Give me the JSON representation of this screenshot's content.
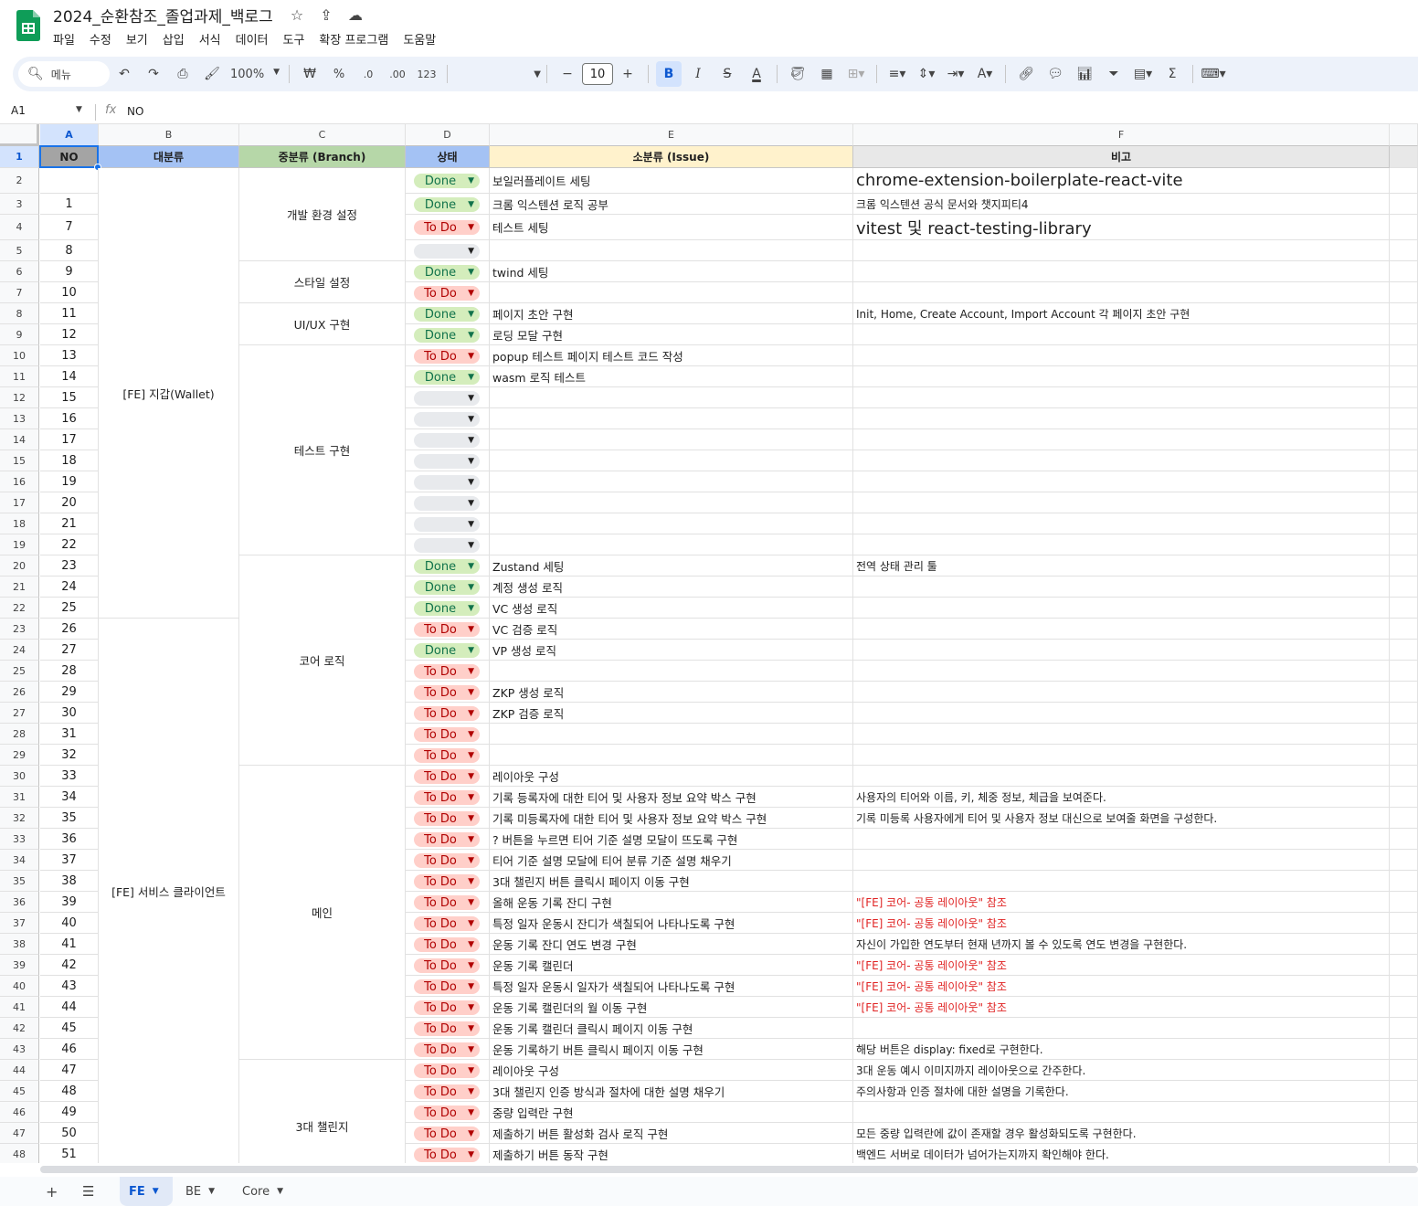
{
  "title_bar": {
    "doc_title": "2024_순환참조_졸업과제_백로그",
    "menu": [
      "파일",
      "수정",
      "보기",
      "삽입",
      "서식",
      "데이터",
      "도구",
      "확장 프로그램",
      "도움말"
    ]
  },
  "toolbar": {
    "search_placeholder": "메뉴",
    "zoom": "100%",
    "currency": "₩",
    "percent": "%",
    "dec_decrease": ".0",
    "dec_increase": ".00",
    "number_format": "123",
    "font_size": "10",
    "bold": "B",
    "italic": "I",
    "strike": "S",
    "text_color": "A"
  },
  "formula_bar": {
    "name_box": "A1",
    "value": "NO"
  },
  "columns": [
    "A",
    "B",
    "C",
    "D",
    "E",
    "F"
  ],
  "header_row": {
    "no": "NO",
    "category": "대분류",
    "branch": "중분류 (Branch)",
    "status": "상태",
    "issue": "소분류 (Issue)",
    "note": "비고"
  },
  "groups": {
    "category": [
      "[FE] 지갑(Wallet)",
      "[FE] 서비스 클라이언트"
    ],
    "branch": [
      "개발 환경 설정",
      "스타일 설정",
      "UI/UX 구현",
      "테스트 구현",
      "코어 로직",
      "메인",
      "3대 챌린지"
    ]
  },
  "rows": [
    {
      "r": "2",
      "no": "",
      "status": "Done",
      "issue": "보일러플레이트 세팅",
      "note": "chrome-extension-boilerplate-react-vite",
      "note_style": "large"
    },
    {
      "r": "3",
      "no": "1",
      "status": "Done",
      "issue": "크롬 익스텐션 로직 공부",
      "note": "크롬 익스텐션 공식 문서와 챗지피티4",
      "note_style": ""
    },
    {
      "r": "4",
      "no": "7",
      "status": "To Do",
      "issue": "테스트 세팅",
      "note": "vitest 및 react-testing-library",
      "note_style": "large"
    },
    {
      "r": "5",
      "no": "8",
      "status": "",
      "issue": "",
      "note": "",
      "note_style": ""
    },
    {
      "r": "6",
      "no": "9",
      "status": "Done",
      "issue": "twind 세팅",
      "note": "",
      "note_style": ""
    },
    {
      "r": "7",
      "no": "10",
      "status": "To Do",
      "issue": "",
      "note": "",
      "note_style": ""
    },
    {
      "r": "8",
      "no": "11",
      "status": "Done",
      "issue": "페이지 초안 구현",
      "note": "Init, Home, Create Account, Import Account 각 페이지 초안 구현",
      "note_style": ""
    },
    {
      "r": "9",
      "no": "12",
      "status": "Done",
      "issue": "로딩 모달 구현",
      "note": "",
      "note_style": ""
    },
    {
      "r": "10",
      "no": "13",
      "status": "To Do",
      "issue": "popup 테스트 페이지 테스트 코드 작성",
      "note": "",
      "note_style": ""
    },
    {
      "r": "11",
      "no": "14",
      "status": "Done",
      "issue": "wasm 로직 테스트",
      "note": "",
      "note_style": ""
    },
    {
      "r": "12",
      "no": "15",
      "status": "",
      "issue": "",
      "note": "",
      "note_style": ""
    },
    {
      "r": "13",
      "no": "16",
      "status": "",
      "issue": "",
      "note": "",
      "note_style": ""
    },
    {
      "r": "14",
      "no": "17",
      "status": "",
      "issue": "",
      "note": "",
      "note_style": ""
    },
    {
      "r": "15",
      "no": "18",
      "status": "",
      "issue": "",
      "note": "",
      "note_style": ""
    },
    {
      "r": "16",
      "no": "19",
      "status": "",
      "issue": "",
      "note": "",
      "note_style": ""
    },
    {
      "r": "17",
      "no": "20",
      "status": "",
      "issue": "",
      "note": "",
      "note_style": ""
    },
    {
      "r": "18",
      "no": "21",
      "status": "",
      "issue": "",
      "note": "",
      "note_style": ""
    },
    {
      "r": "19",
      "no": "22",
      "status": "",
      "issue": "",
      "note": "",
      "note_style": ""
    },
    {
      "r": "20",
      "no": "23",
      "status": "Done",
      "issue": "Zustand 세팅",
      "note": "전역 상태 관리 툴",
      "note_style": ""
    },
    {
      "r": "21",
      "no": "24",
      "status": "Done",
      "issue": "계정 생성 로직",
      "note": "",
      "note_style": ""
    },
    {
      "r": "22",
      "no": "25",
      "status": "Done",
      "issue": "VC 생성 로직",
      "note": "",
      "note_style": ""
    },
    {
      "r": "23",
      "no": "26",
      "status": "To Do",
      "issue": "VC 검증 로직",
      "note": "",
      "note_style": ""
    },
    {
      "r": "24",
      "no": "27",
      "status": "Done",
      "issue": "VP 생성 로직",
      "note": "",
      "note_style": ""
    },
    {
      "r": "25",
      "no": "28",
      "status": "To Do",
      "issue": "",
      "note": "",
      "note_style": ""
    },
    {
      "r": "26",
      "no": "29",
      "status": "To Do",
      "issue": "ZKP 생성 로직",
      "note": "",
      "note_style": ""
    },
    {
      "r": "27",
      "no": "30",
      "status": "To Do",
      "issue": "ZKP 검증 로직",
      "note": "",
      "note_style": ""
    },
    {
      "r": "28",
      "no": "31",
      "status": "To Do",
      "issue": "",
      "note": "",
      "note_style": ""
    },
    {
      "r": "29",
      "no": "32",
      "status": "To Do",
      "issue": "",
      "note": "",
      "note_style": ""
    },
    {
      "r": "30",
      "no": "33",
      "status": "To Do",
      "issue": "레이아웃 구성",
      "note": "",
      "note_style": ""
    },
    {
      "r": "31",
      "no": "34",
      "status": "To Do",
      "issue": "기록 등록자에 대한 티어 및 사용자 정보 요약 박스 구현",
      "note": "사용자의 티어와 이름, 키, 체중 정보, 체급을 보여준다.",
      "note_style": ""
    },
    {
      "r": "32",
      "no": "35",
      "status": "To Do",
      "issue": "기록 미등록자에 대한 티어 및 사용자 정보 요약 박스 구현",
      "note": "기록 미등록 사용자에게 티어 및 사용자 정보 대신으로 보여줄 화면을 구성한다.",
      "note_style": ""
    },
    {
      "r": "33",
      "no": "36",
      "status": "To Do",
      "issue": "? 버튼을 누르면 티어 기준 설명 모달이 뜨도록 구현",
      "note": "",
      "note_style": ""
    },
    {
      "r": "34",
      "no": "37",
      "status": "To Do",
      "issue": "티어 기준 설명 모달에 티어 분류 기준 설명 채우기",
      "note": "",
      "note_style": ""
    },
    {
      "r": "35",
      "no": "38",
      "status": "To Do",
      "issue": "3대 챌린지 버튼 클릭시 페이지 이동 구현",
      "note": "",
      "note_style": ""
    },
    {
      "r": "36",
      "no": "39",
      "status": "To Do",
      "issue": "올해 운동 기록 잔디 구현",
      "note": "\"[FE] 코어- 공통 레이아웃\" 참조",
      "note_style": "red"
    },
    {
      "r": "37",
      "no": "40",
      "status": "To Do",
      "issue": "특정 일자 운동시 잔디가 색칠되어 나타나도록 구현",
      "note": "\"[FE] 코어- 공통 레이아웃\" 참조",
      "note_style": "red"
    },
    {
      "r": "38",
      "no": "41",
      "status": "To Do",
      "issue": "운동 기록 잔디 연도 변경 구현",
      "note": "자신이 가입한 연도부터 현재 년까지 볼 수 있도록 연도 변경을 구현한다.",
      "note_style": ""
    },
    {
      "r": "39",
      "no": "42",
      "status": "To Do",
      "issue": "운동 기록 캘린더",
      "note": "\"[FE] 코어- 공통 레이아웃\" 참조",
      "note_style": "red"
    },
    {
      "r": "40",
      "no": "43",
      "status": "To Do",
      "issue": "특정 일자 운동시 일자가 색칠되어 나타나도록 구현",
      "note": "\"[FE] 코어- 공통 레이아웃\" 참조",
      "note_style": "red"
    },
    {
      "r": "41",
      "no": "44",
      "status": "To Do",
      "issue": "운동 기록 캘린더의 월 이동 구현",
      "note": "\"[FE] 코어- 공통 레이아웃\" 참조",
      "note_style": "red"
    },
    {
      "r": "42",
      "no": "45",
      "status": "To Do",
      "issue": "운동 기록 캘린더 클릭시 페이지 이동 구현",
      "note": "",
      "note_style": ""
    },
    {
      "r": "43",
      "no": "46",
      "status": "To Do",
      "issue": "운동 기록하기 버튼 클릭시 페이지 이동 구현",
      "note": "해당 버튼은 display: fixed로 구현한다.",
      "note_style": ""
    },
    {
      "r": "44",
      "no": "47",
      "status": "To Do",
      "issue": "레이아웃 구성",
      "note": "3대 운동 예시 이미지까지 레이아웃으로 간주한다.",
      "note_style": ""
    },
    {
      "r": "45",
      "no": "48",
      "status": "To Do",
      "issue": "3대 챌린지 인증 방식과 절차에 대한 설명 채우기",
      "note": "주의사항과 인증 절차에 대한 설명을 기록한다.",
      "note_style": ""
    },
    {
      "r": "46",
      "no": "49",
      "status": "To Do",
      "issue": "중량 입력란 구현",
      "note": "",
      "note_style": ""
    },
    {
      "r": "47",
      "no": "50",
      "status": "To Do",
      "issue": "제출하기 버튼 활성화 검사 로직 구현",
      "note": "모든 중량 입력란에 값이 존재할 경우 활성화되도록 구현한다.",
      "note_style": ""
    },
    {
      "r": "48",
      "no": "51",
      "status": "To Do",
      "issue": "제출하기 버튼 동작 구현",
      "note": "백엔드 서버로 데이터가 넘어가는지까지 확인해야 한다.",
      "note_style": ""
    }
  ],
  "sheet_tabs": [
    "FE",
    "BE",
    "Core"
  ],
  "colors": {
    "header_no": "#a4a4a4",
    "header_category": "#a4c2f4",
    "header_branch": "#b6d7a8",
    "header_status": "#a4c2f4",
    "header_issue": "#fff2cc",
    "header_note": "#e8e8e8",
    "done_chip": "#d4edbc",
    "todo_chip": "#ffcfc9"
  }
}
